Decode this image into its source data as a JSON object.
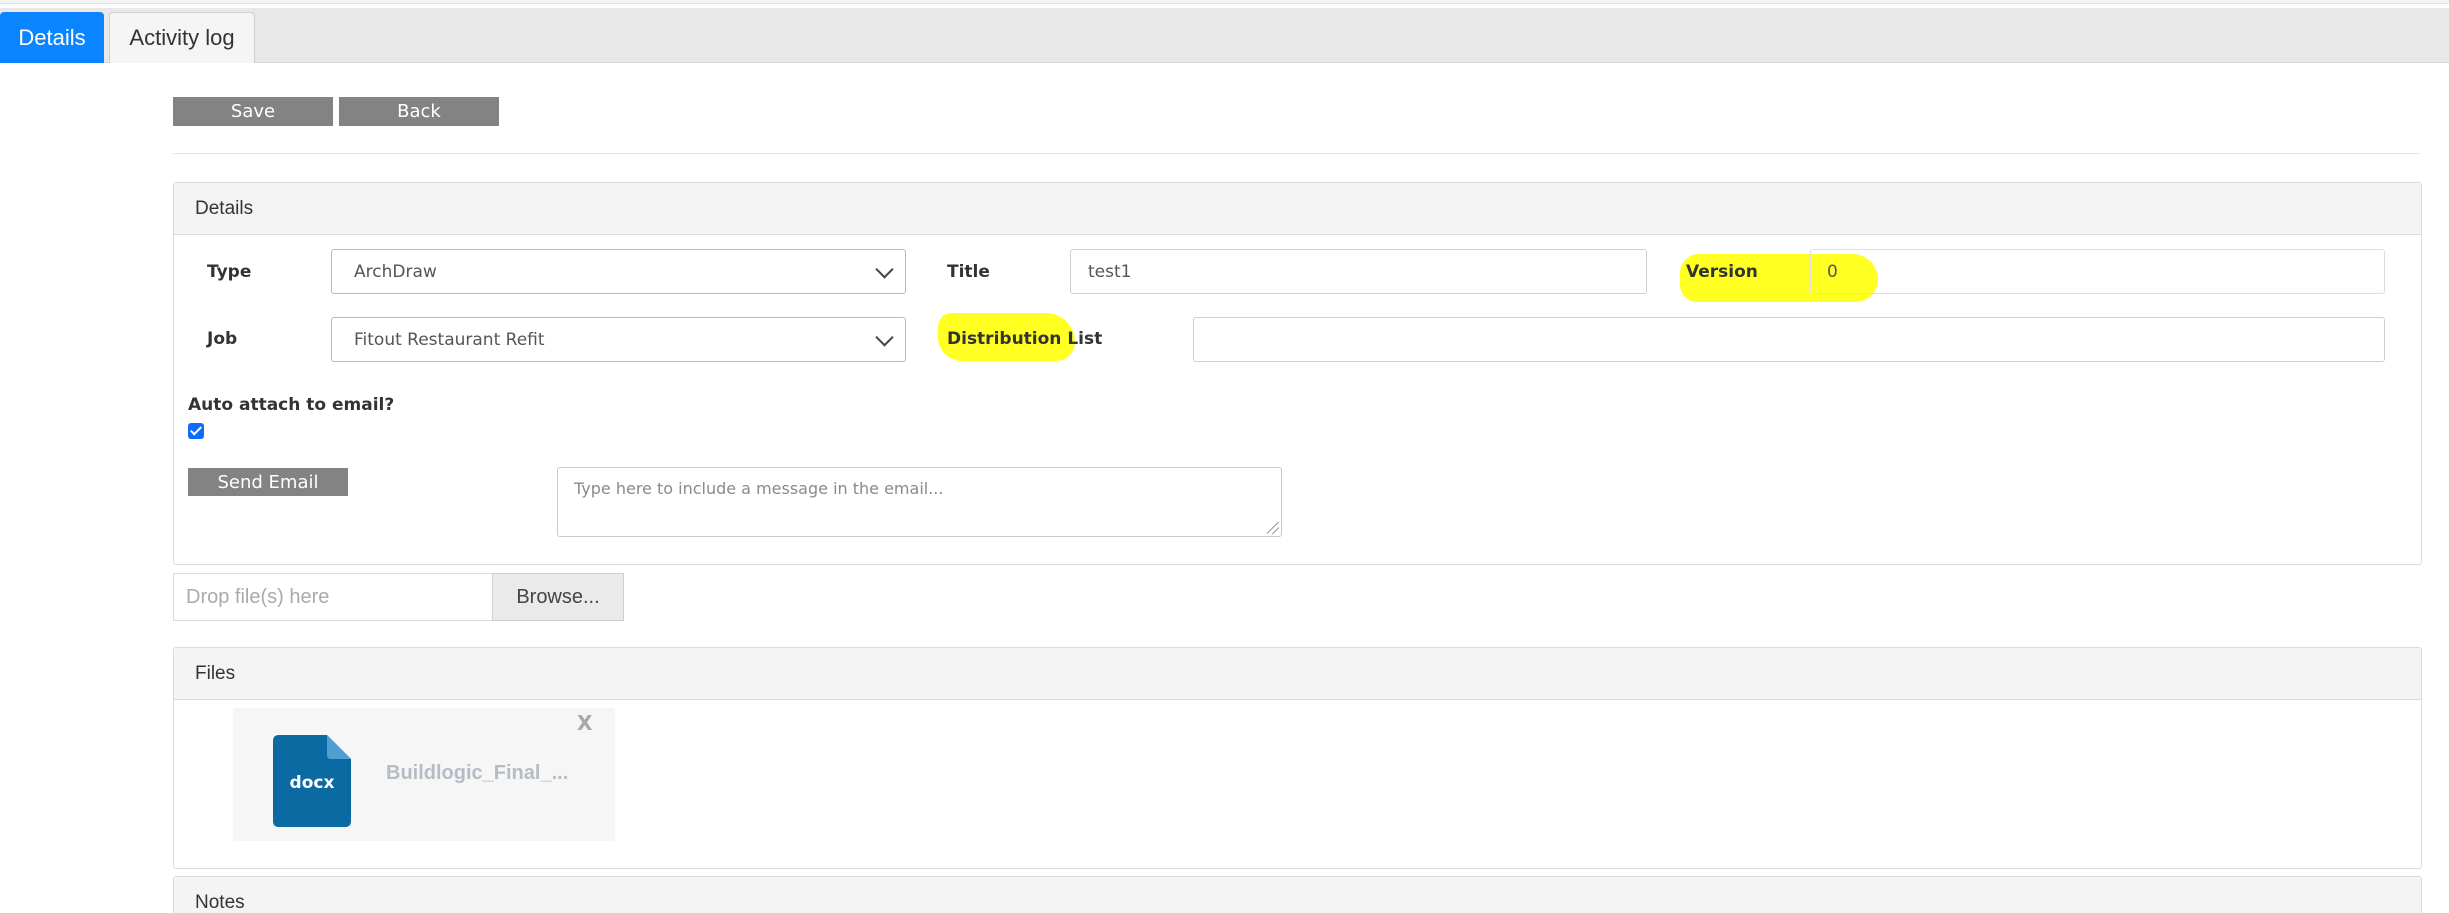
{
  "tabs": [
    {
      "label": "Details",
      "active": true
    },
    {
      "label": "Activity log",
      "active": false
    }
  ],
  "toolbar": {
    "save_label": "Save",
    "back_label": "Back"
  },
  "details_panel": {
    "title": "Details",
    "type_label": "Type",
    "type_value": "ArchDraw",
    "title_label": "Title",
    "title_value": "test1",
    "version_label": "Version",
    "version_value": "0",
    "job_label": "Job",
    "job_value": "Fitout Restaurant Refit",
    "distribution_label": "Distribution List",
    "distribution_value": "",
    "auto_attach_label": "Auto attach to email?",
    "auto_attach_checked": true,
    "send_email_label": "Send Email",
    "email_message_placeholder": "Type here to include a message in the email...",
    "highlight_color": "#ffff22"
  },
  "upload": {
    "drop_placeholder": "Drop file(s) here",
    "browse_label": "Browse..."
  },
  "files_panel": {
    "title": "Files",
    "files": [
      {
        "extension": "docx",
        "name": "Buildlogic_Final_...",
        "remove_label": "X"
      }
    ]
  },
  "notes_panel": {
    "title": "Notes"
  },
  "colors": {
    "accent": "#0a84ff",
    "button_gray": "#838383",
    "file_icon": "#0b6aa2"
  }
}
